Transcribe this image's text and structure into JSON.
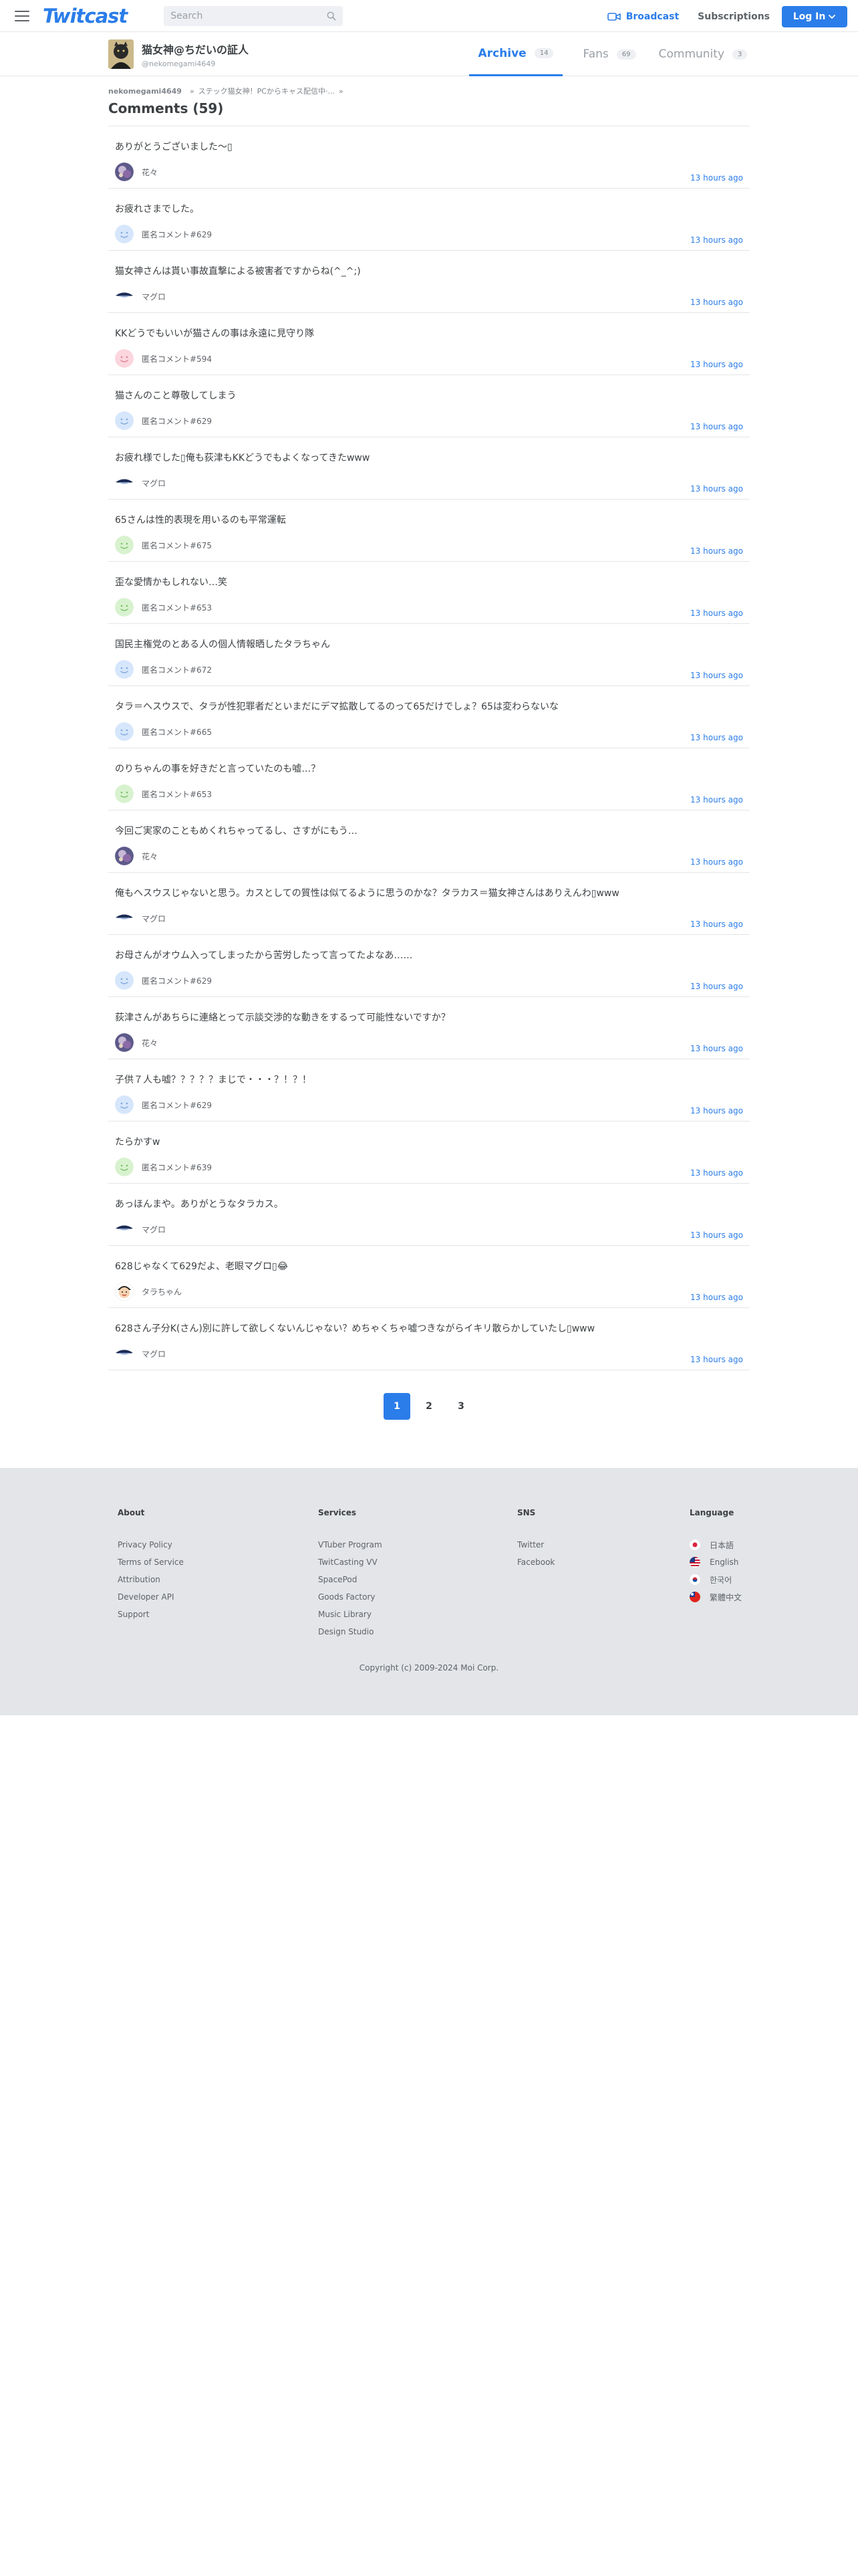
{
  "header": {
    "logo": "Twitcast",
    "search_placeholder": "Search",
    "broadcast_label": "Broadcast",
    "subscriptions_label": "Subscriptions",
    "login_label": "Log In",
    "icons": [
      "menu-icon",
      "search-icon",
      "broadcast-camera-icon",
      "chevron-down-icon"
    ]
  },
  "profile": {
    "name": "猫女神@ちだいの証人",
    "handle": "@nekomegami4649",
    "tabs": [
      {
        "label": "Archive",
        "count": "14",
        "active": true
      },
      {
        "label": "Fans",
        "count": "69",
        "active": false
      },
      {
        "label": "Community",
        "count": "3",
        "active": false
      }
    ]
  },
  "breadcrumb": {
    "user": "nekomegami4649",
    "separator": "»",
    "title": "ステック猫女神！PCからキャス配信中·...",
    "trailing": "»"
  },
  "comments_heading": "Comments (59)",
  "comments": [
    {
      "text": "ありがとうございました〜▯",
      "user": "花々",
      "time": "13 hours ago",
      "avatar": "photo"
    },
    {
      "text": "お疲れさまでした。",
      "user": "匿名コメント#629",
      "time": "13 hours ago",
      "avatar": "blue"
    },
    {
      "text": "猫女神さんは貰い事故直撃による被害者ですからね(^_^;)",
      "user": "マグロ",
      "time": "13 hours ago",
      "avatar": "tuna"
    },
    {
      "text": "KKどうでもいいが猫さんの事は永遠に見守り隊",
      "user": "匿名コメント#594",
      "time": "13 hours ago",
      "avatar": "pink"
    },
    {
      "text": "猫さんのこと尊敬してしまう",
      "user": "匿名コメント#629",
      "time": "13 hours ago",
      "avatar": "blue"
    },
    {
      "text": "お疲れ様でした▯俺も荻津もKKどうでもよくなってきたwww",
      "user": "マグロ",
      "time": "13 hours ago",
      "avatar": "tuna"
    },
    {
      "text": "65さんは性的表現を用いるのも平常運転",
      "user": "匿名コメント#675",
      "time": "13 hours ago",
      "avatar": "green"
    },
    {
      "text": "歪な愛情かもしれない…笑",
      "user": "匿名コメント#653",
      "time": "13 hours ago",
      "avatar": "green"
    },
    {
      "text": "国民主権党のとある人の個人情報晒したタラちゃん",
      "user": "匿名コメント#672",
      "time": "13 hours ago",
      "avatar": "blue"
    },
    {
      "text": "タラ＝ヘスウスで、タラが性犯罪者だといまだにデマ拡散してるのって65だけでしょ？65は変わらないな",
      "user": "匿名コメント#665",
      "time": "13 hours ago",
      "avatar": "blue"
    },
    {
      "text": "のりちゃんの事を好きだと言っていたのも嘘…？",
      "user": "匿名コメント#653",
      "time": "13 hours ago",
      "avatar": "green"
    },
    {
      "text": "今回ご実家のこともめくれちゃってるし、さすがにもう…",
      "user": "花々",
      "time": "13 hours ago",
      "avatar": "photo"
    },
    {
      "text": "俺もヘスウスじゃないと思う。カスとしての質性は似てるように思うのかな？タラカス＝猫女神さんはありえんわ▯www",
      "user": "マグロ",
      "time": "13 hours ago",
      "avatar": "tuna"
    },
    {
      "text": "お母さんがオウム入ってしまったから苦労したって言ってたよなあ……",
      "user": "匿名コメント#629",
      "time": "13 hours ago",
      "avatar": "blue"
    },
    {
      "text": "荻津さんがあちらに連絡とって示談交渉的な動きをするって可能性ないですか？",
      "user": "花々",
      "time": "13 hours ago",
      "avatar": "photo"
    },
    {
      "text": "子供７人も嘘？？？？？まじで・・・？！？！",
      "user": "匿名コメント#629",
      "time": "13 hours ago",
      "avatar": "blue"
    },
    {
      "text": "たらかすw",
      "user": "匿名コメント#639",
      "time": "13 hours ago",
      "avatar": "green"
    },
    {
      "text": "あっほんまや。ありがとうなタラカス。",
      "user": "マグロ",
      "time": "13 hours ago",
      "avatar": "tuna"
    },
    {
      "text": "628じゃなくて629だよ、老眼マグロ▯😂",
      "user": "タラちゃん",
      "time": "13 hours ago",
      "avatar": "tara"
    },
    {
      "text": "628さん子分K(さん)別に許して欲しくないんじゃない？めちゃくちゃ嘘つきながらイキリ散らかしていたし▯www",
      "user": "マグロ",
      "time": "13 hours ago",
      "avatar": "tuna"
    }
  ],
  "pagination": {
    "pages": [
      "1",
      "2",
      "3"
    ],
    "active": "1"
  },
  "footer": {
    "about": {
      "heading": "About",
      "links": [
        "Privacy Policy",
        "Terms of Service",
        "Attribution",
        "Developer API",
        "Support"
      ]
    },
    "services": {
      "heading": "Services",
      "links": [
        "VTuber Program",
        "TwitCasting VV",
        "SpacePod",
        "Goods Factory",
        "Music Library",
        "Design Studio"
      ]
    },
    "sns": {
      "heading": "SNS",
      "links": [
        "Twitter",
        "Facebook"
      ]
    },
    "language": {
      "heading": "Language",
      "links": [
        "日本語",
        "English",
        "한국어",
        "繁體中文"
      ]
    },
    "copyright": "Copyright (c) 2009-2024 Moi Corp."
  },
  "colors": {
    "accent": "#2b7de9",
    "footer_bg": "#e3e5e8",
    "divider": "#e3e5e8"
  }
}
